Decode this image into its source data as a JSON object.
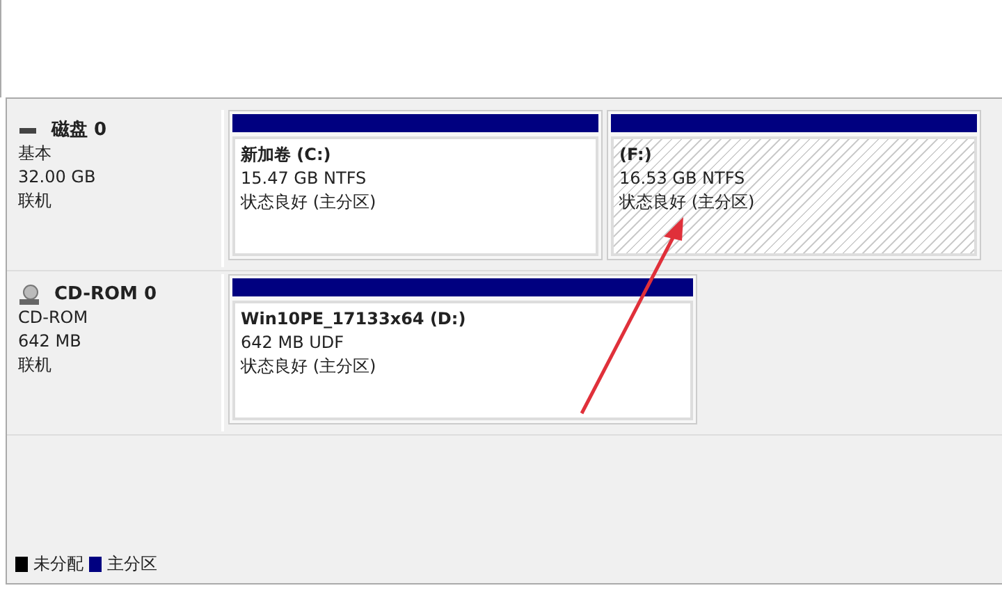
{
  "disks": [
    {
      "kind": "disk",
      "name": "磁盘 0",
      "type": "基本",
      "size": "32.00 GB",
      "status": "联机",
      "partitions": [
        {
          "label": "新加卷  (C:)",
          "size": "15.47 GB NTFS",
          "status": "状态良好 (主分区)",
          "selected": false
        },
        {
          "label": "(F:)",
          "size": "16.53 GB NTFS",
          "status": "状态良好 (主分区)",
          "selected": true
        }
      ]
    },
    {
      "kind": "cdrom",
      "name": "CD-ROM 0",
      "type": "CD-ROM",
      "size": "642 MB",
      "status": "联机",
      "partitions": [
        {
          "label": "Win10PE_17133x64  (D:)",
          "size": "642 MB UDF",
          "status": "状态良好 (主分区)",
          "selected": false
        }
      ]
    }
  ],
  "legend": [
    {
      "label": "未分配",
      "color": "#000000"
    },
    {
      "label": "主分区",
      "color": "#000080"
    }
  ]
}
